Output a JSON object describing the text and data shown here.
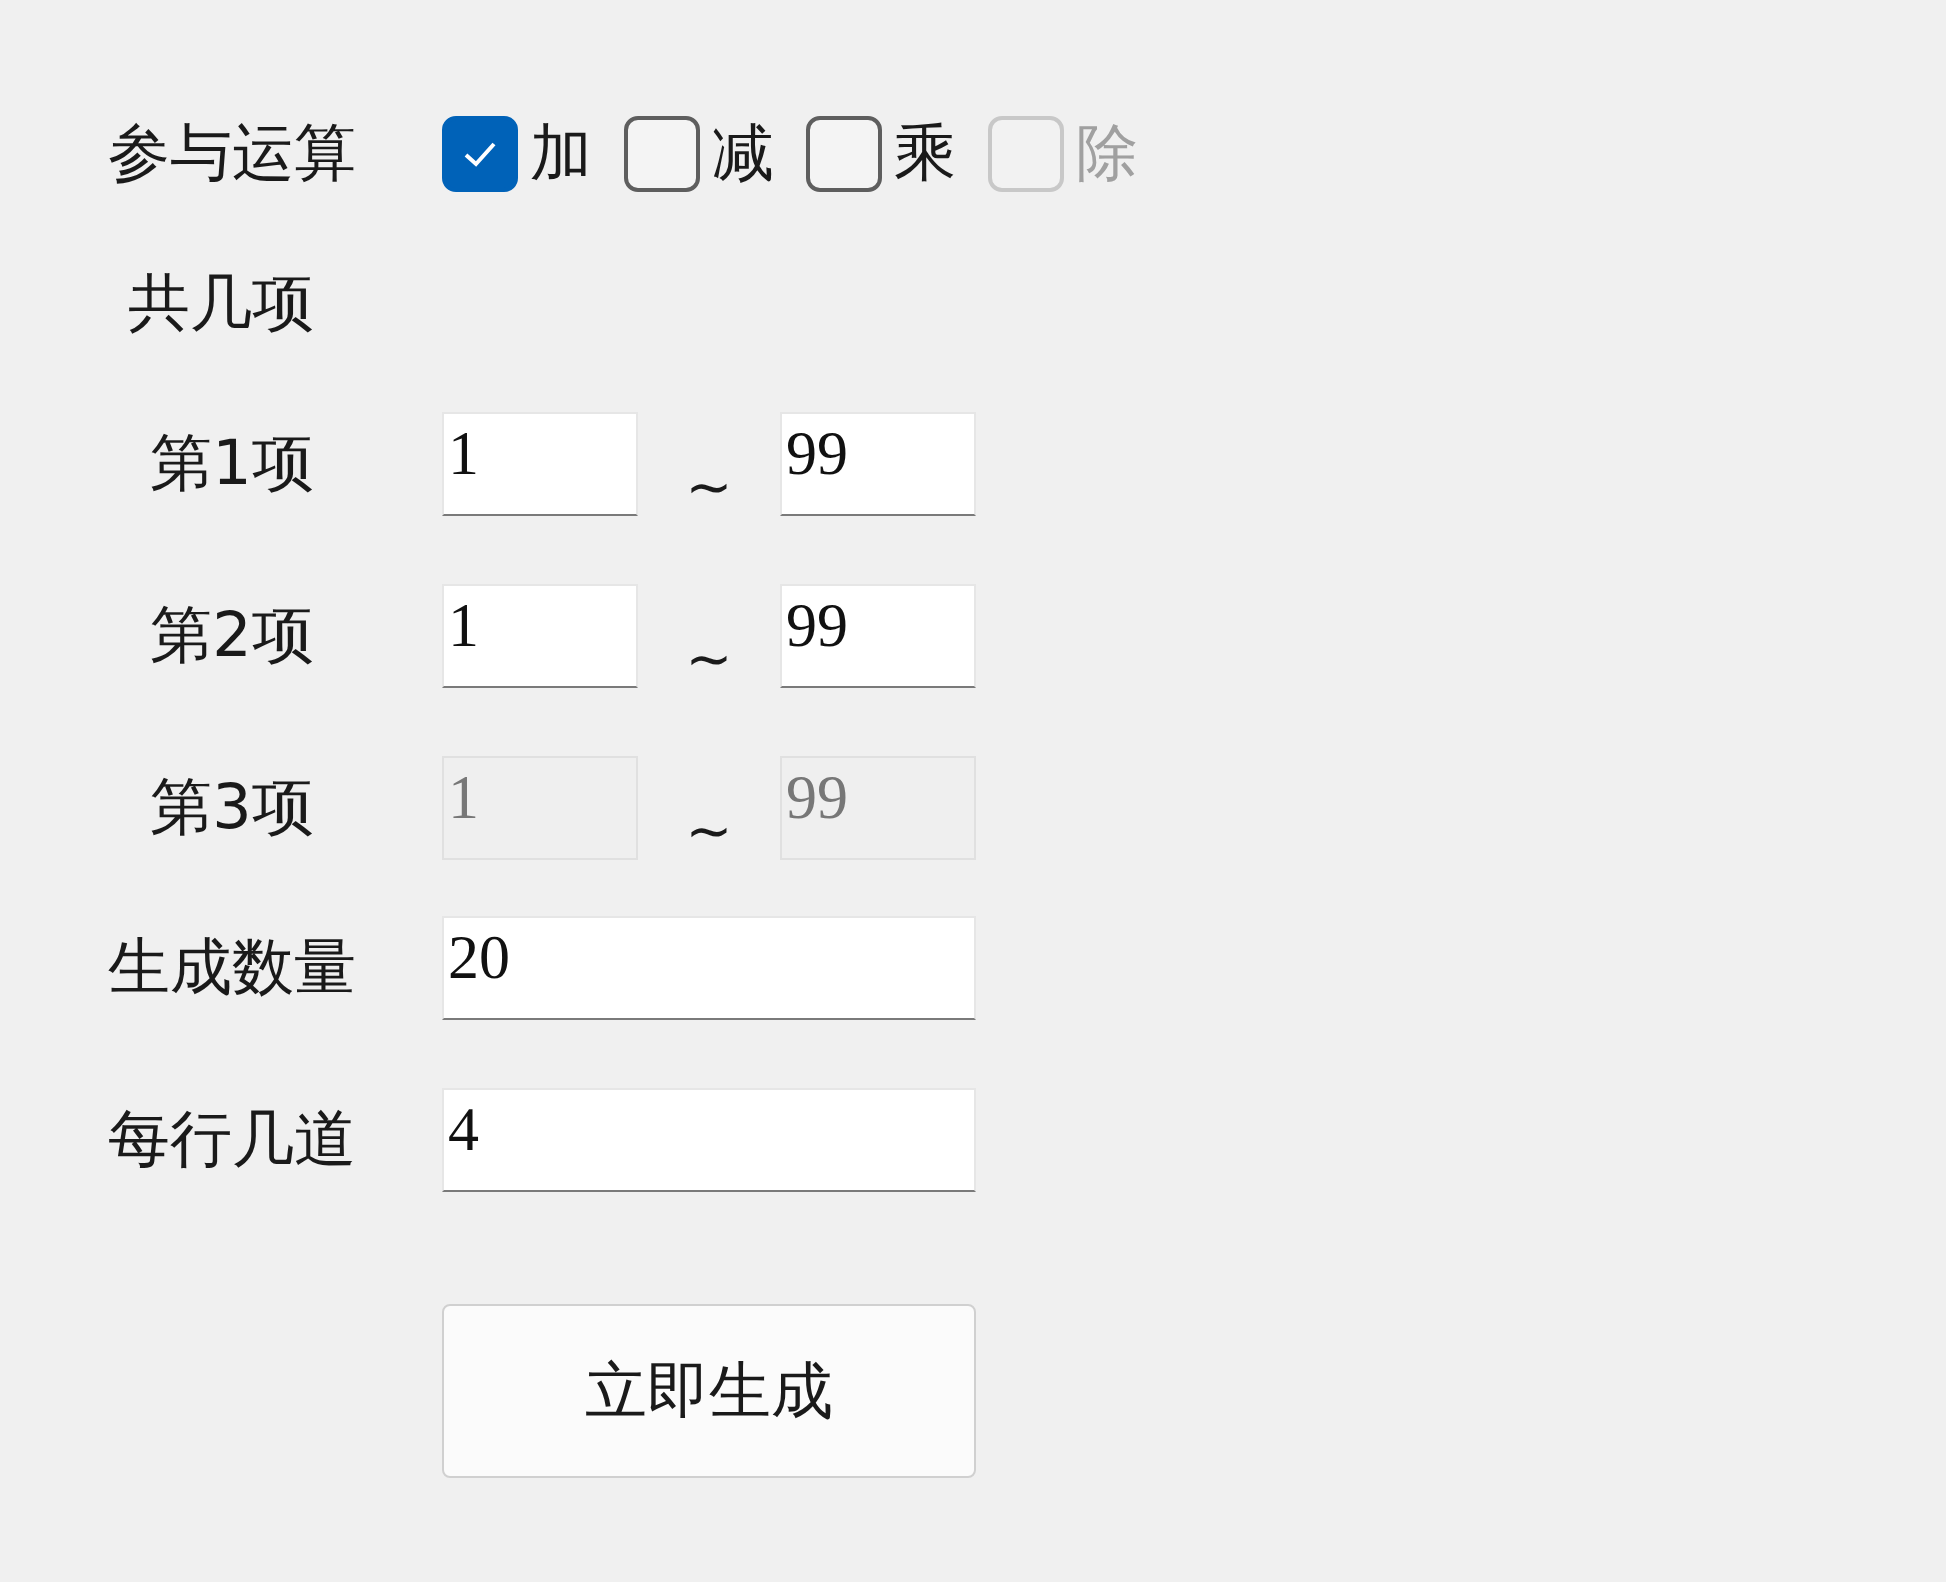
{
  "operations": {
    "label": "参与运算",
    "options": [
      {
        "label": "加",
        "checked": true,
        "disabled": false
      },
      {
        "label": "减",
        "checked": false,
        "disabled": false
      },
      {
        "label": "乘",
        "checked": false,
        "disabled": false
      },
      {
        "label": "除",
        "checked": false,
        "disabled": true
      }
    ]
  },
  "term_count": {
    "label": "共几项"
  },
  "terms": [
    {
      "label": "第1项",
      "min": "1",
      "separator": "~",
      "max": "99",
      "disabled": false
    },
    {
      "label": "第2项",
      "min": "1",
      "separator": "~",
      "max": "99",
      "disabled": false
    },
    {
      "label": "第3项",
      "min": "1",
      "separator": "~",
      "max": "99",
      "disabled": true
    }
  ],
  "quantity": {
    "label": "生成数量",
    "value": "20"
  },
  "per_row": {
    "label": "每行几道",
    "value": "4"
  },
  "generate_button": {
    "label": "立即生成"
  }
}
